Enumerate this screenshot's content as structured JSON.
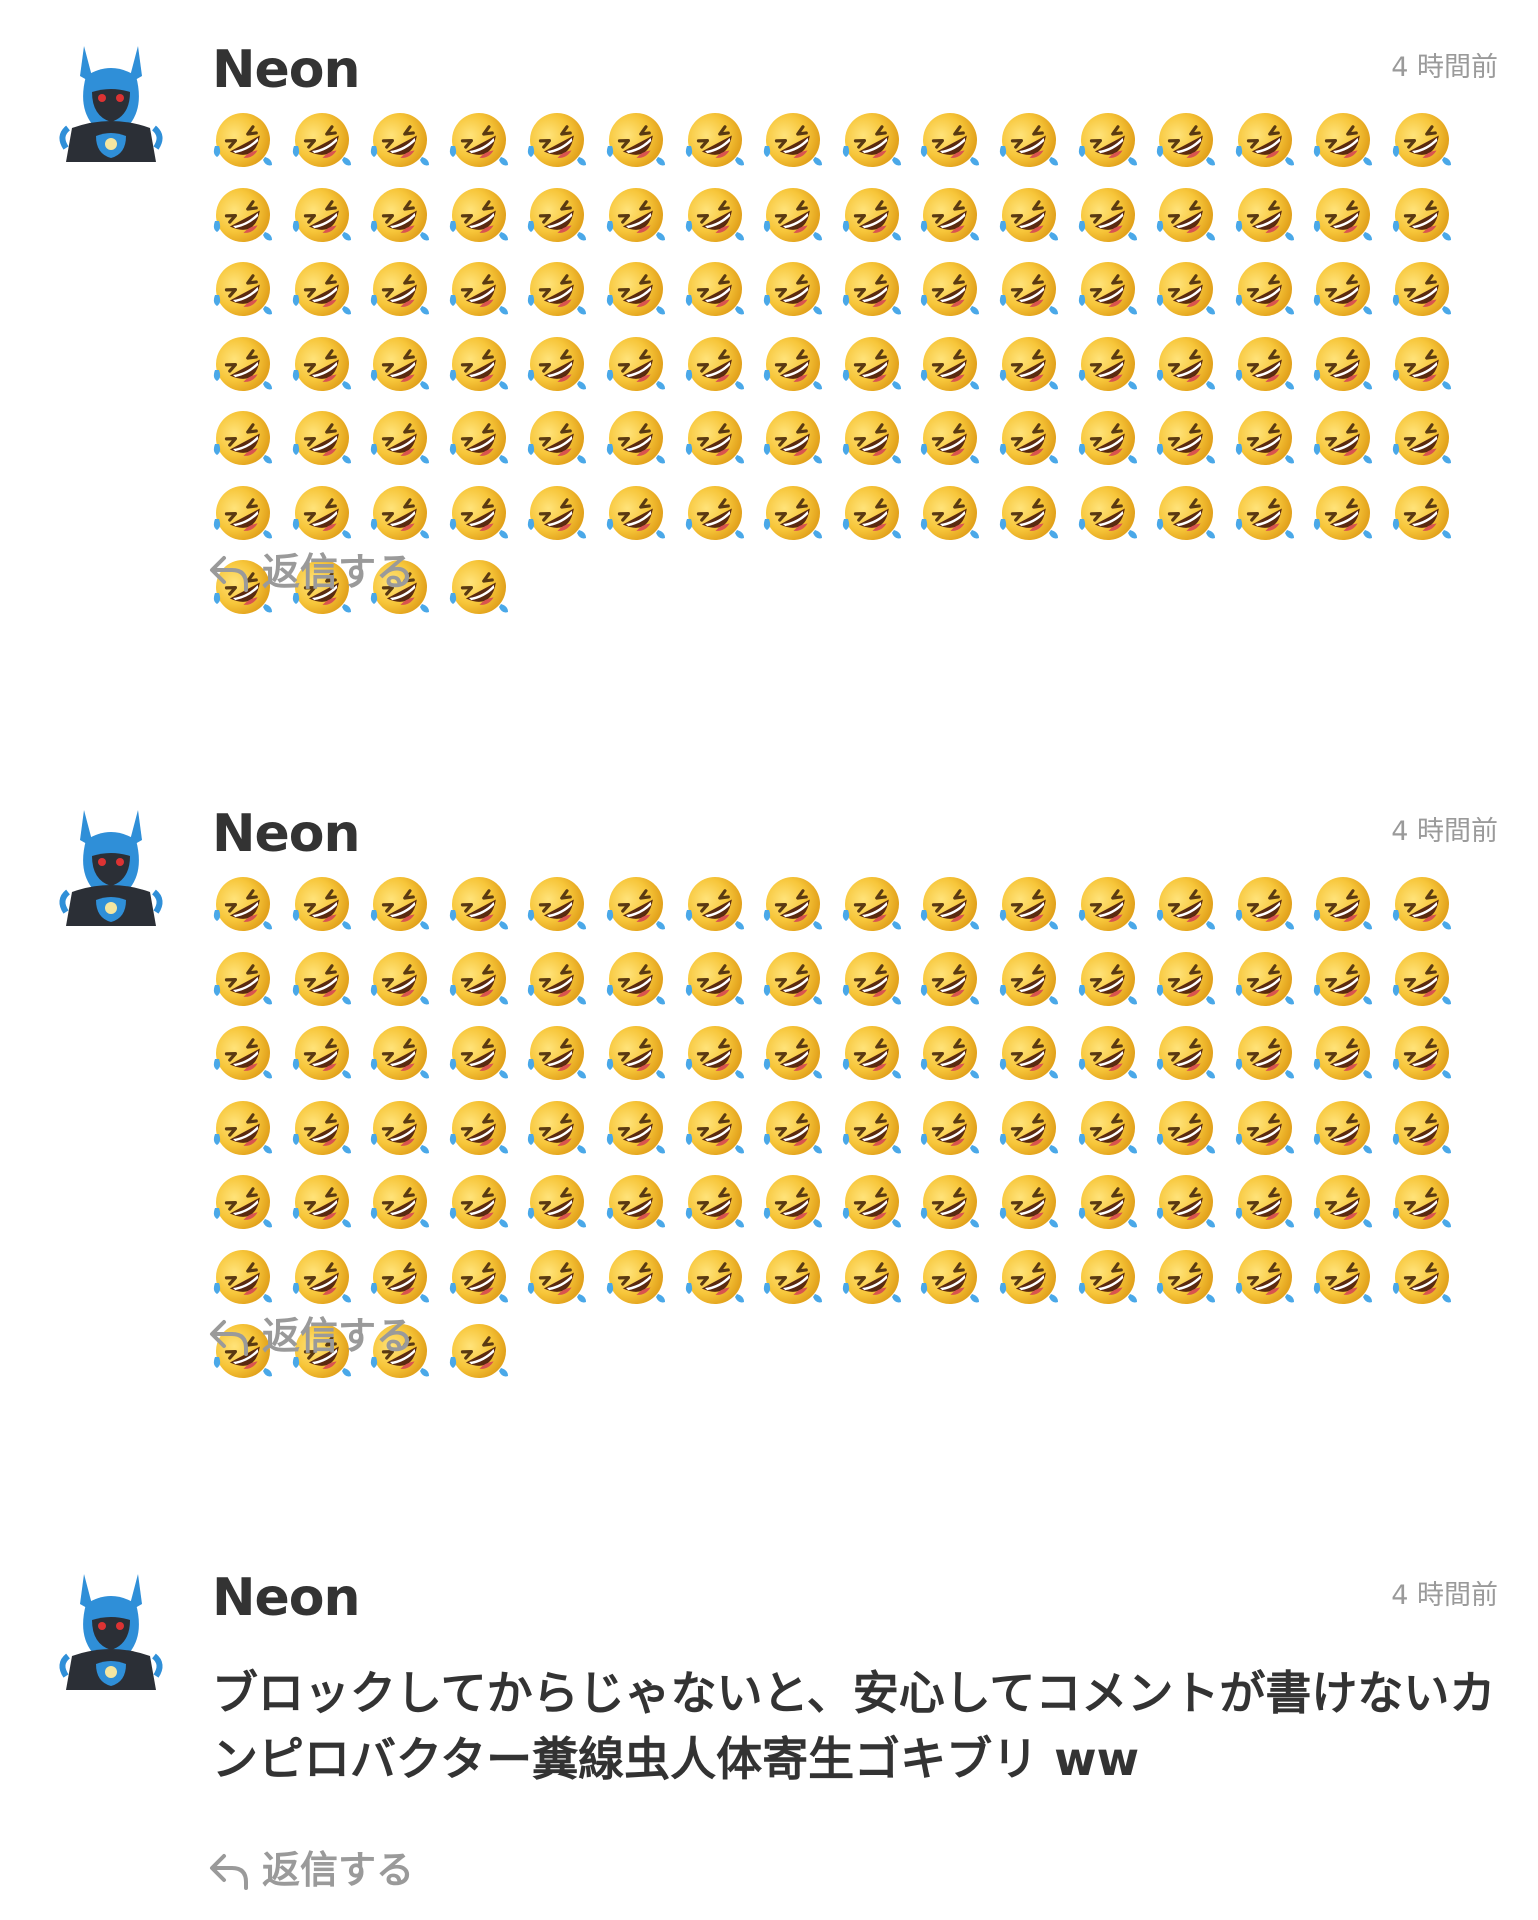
{
  "comments": [
    {
      "username": "Neon",
      "timestamp": "4 時間前",
      "body": "🤣🤣🤣🤣🤣🤣🤣🤣🤣🤣🤣🤣🤣🤣🤣🤣🤣🤣🤣🤣🤣🤣🤣🤣🤣🤣🤣🤣🤣🤣🤣🤣🤣🤣🤣🤣🤣🤣🤣🤣🤣🤣🤣🤣🤣🤣🤣🤣🤣🤣🤣🤣🤣🤣🤣🤣🤣🤣🤣🤣🤣🤣🤣🤣🤣🤣🤣🤣🤣🤣🤣🤣🤣🤣🤣🤣🤣🤣🤣🤣🤣🤣🤣🤣🤣🤣🤣🤣🤣🤣🤣🤣🤣🤣🤣🤣🤣🤣🤣🤣",
      "emoji_icon": "rolling-on-the-floor-laughing-emoji",
      "emoji_count": 100,
      "reply_label": "返信する",
      "reply_icon": "reply-arrow-icon",
      "avatar_icon": "lucario-avatar"
    },
    {
      "username": "Neon",
      "timestamp": "4 時間前",
      "body": "🤣🤣🤣🤣🤣🤣🤣🤣🤣🤣🤣🤣🤣🤣🤣🤣🤣🤣🤣🤣🤣🤣🤣🤣🤣🤣🤣🤣🤣🤣🤣🤣🤣🤣🤣🤣🤣🤣🤣🤣🤣🤣🤣🤣🤣🤣🤣🤣🤣🤣🤣🤣🤣🤣🤣🤣🤣🤣🤣🤣🤣🤣🤣🤣🤣🤣🤣🤣🤣🤣🤣🤣🤣🤣🤣🤣🤣🤣🤣🤣🤣🤣🤣🤣🤣🤣🤣🤣🤣🤣🤣🤣🤣🤣🤣🤣🤣🤣🤣🤣",
      "emoji_icon": "rolling-on-the-floor-laughing-emoji",
      "emoji_count": 100,
      "reply_label": "返信する",
      "reply_icon": "reply-arrow-icon",
      "avatar_icon": "lucario-avatar"
    },
    {
      "username": "Neon",
      "timestamp": "4 時間前",
      "body": "ブロックしてからじゃないと、安心してコメントが書けないカンピロバクター糞線虫人体寄生ゴキブリ ww",
      "reply_label": "返信する",
      "reply_icon": "reply-arrow-icon",
      "avatar_icon": "lucario-avatar"
    }
  ],
  "colors": {
    "text": "#333333",
    "muted": "#9a9a9a",
    "background": "#ffffff",
    "emoji_face": "#f5c53a",
    "emoji_tear": "#4aa8e8",
    "avatar_blue": "#2f8fd8",
    "avatar_dark": "#2b2f36"
  }
}
